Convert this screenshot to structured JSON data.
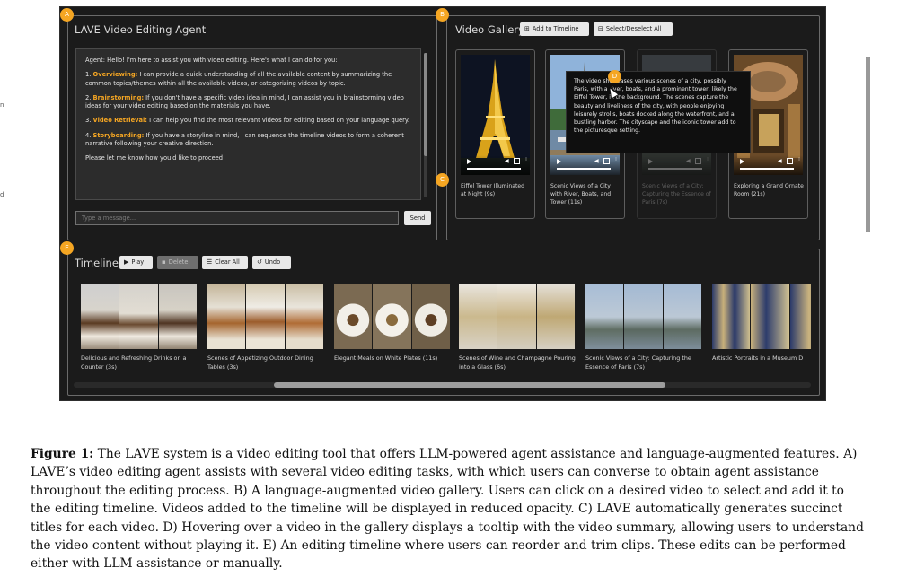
{
  "agent_panel": {
    "badge": "A",
    "title": "LAVE Video Editing Agent",
    "intro": "Agent: Hello! I'm here to assist you with video editing. Here's what I can do for you:",
    "items": [
      {
        "num": "1.",
        "key": "Overviewing:",
        "text": " I can provide a quick understanding of all the available content by summarizing the common topics/themes within all the available videos, or categorizing videos by topic."
      },
      {
        "num": "2.",
        "key": "Brainstorming:",
        "text": " If you don't have a specific video idea in mind, I can assist you in brainstorming video ideas for your video editing based on the materials you have."
      },
      {
        "num": "3.",
        "key": "Video Retrieval:",
        "text": " I can help you find the most relevant videos for editing based on your language query."
      },
      {
        "num": "4.",
        "key": "Storyboarding:",
        "text": " If you have a storyline in mind, I can sequence the timeline videos to form a coherent narrative following your creative direction."
      }
    ],
    "closing": "Please let me know how you'd like to proceed!",
    "input_placeholder": "Type a message...",
    "send_label": "Send"
  },
  "gallery": {
    "badge": "B",
    "badge_c": "C",
    "badge_d": "D",
    "title": "Video Gallery",
    "add_label": "Add to Timeline",
    "select_label": "Select/Deselect All",
    "videos": [
      {
        "title": "Eiffel Tower Illuminated at Night (9s)"
      },
      {
        "title": "Scenic Views of a City with River, Boats, and Tower (11s)"
      },
      {
        "title": "Scenic Views of a City: Capturing the Essence of Paris (7s)"
      },
      {
        "title": "Exploring a Grand Ornate Room (21s)"
      }
    ],
    "tooltip": "The video showcases various scenes of a city, possibly Paris, with a river, boats, and a prominent tower, likely the Eiffel Tower, in the background. The scenes capture the beauty and liveliness of the city, with people enjoying leisurely strolls, boats docked along the waterfront, and a bustling harbor. The cityscape and the iconic tower add to the picturesque setting."
  },
  "timeline": {
    "badge": "E",
    "title": "Timeline",
    "play_label": "Play",
    "delete_label": "Delete",
    "clear_label": "Clear All",
    "undo_label": "Undo",
    "clips": [
      {
        "title": "Delicious and Refreshing Drinks on a Counter (3s)"
      },
      {
        "title": "Scenes of Appetizing Outdoor Dining Tables (3s)"
      },
      {
        "title": "Elegant Meals on White Plates (11s)"
      },
      {
        "title": "Scenes of Wine and Champagne Pouring into a Glass (6s)"
      },
      {
        "title": "Scenic Views of a City: Capturing the Essence of Paris (7s)"
      },
      {
        "title": "Artistic Portraits in a Museum D"
      }
    ]
  },
  "caption": {
    "label": "Figure 1:",
    "text": " The LAVE system is a video editing tool that offers LLM-powered agent assistance and language-augmented features. A) LAVE’s video editing agent assists with several video editing tasks, with which users can converse to obtain agent assistance throughout the editing process. B) A language-augmented video gallery. Users can click on a desired video to select and add it to the editing timeline. Videos added to the timeline will be displayed in reduced opacity. C) LAVE automatically generates succinct titles for each video. D) Hovering over a video in the gallery displays a tooltip with the video summary, allowing users to understand the video content without playing it. E) An editing timeline where users can reorder and trim clips. These edits can be performed either with LLM assistance or manually."
  },
  "margin_marks": [
    "n",
    "d"
  ],
  "colors": {
    "badge": "#f5a623",
    "app_bg": "#1b1b1b",
    "keyword": "#f5a623"
  }
}
